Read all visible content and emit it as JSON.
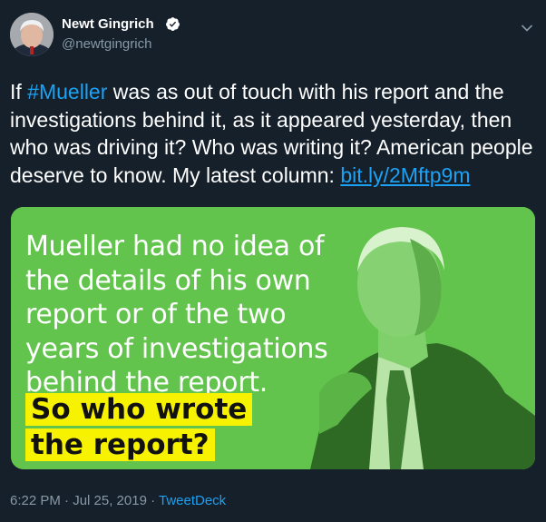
{
  "author": {
    "name": "Newt Gingrich",
    "handle": "@newtgingrich",
    "avatar_icon": "profile-photo",
    "verified_icon": "verified-badge-icon"
  },
  "tweet": {
    "text_prefix": "If ",
    "hashtag": "#Mueller",
    "text_main": " was as out of touch with his report and the investigations behind it, as it appeared yesterday, then who was driving it? Who was writing it? American people deserve to know. My latest column: ",
    "link": "bit.ly/2Mftp9m"
  },
  "media": {
    "quote_lines": [
      "Mueller had no idea of",
      "the details of his own",
      "report or of the two",
      "years of investigations",
      "behind the report."
    ],
    "highlight_lines": [
      "So who wrote",
      "the report?"
    ],
    "colors": {
      "overlay": "#62c44d",
      "highlight": "#f7f200"
    }
  },
  "meta": {
    "timestamp": "6:22 PM · Jul 25, 2019 · ",
    "source": "TweetDeck"
  },
  "colors": {
    "background": "#15202b",
    "accent": "#1da1f2",
    "muted": "#8899a6"
  }
}
